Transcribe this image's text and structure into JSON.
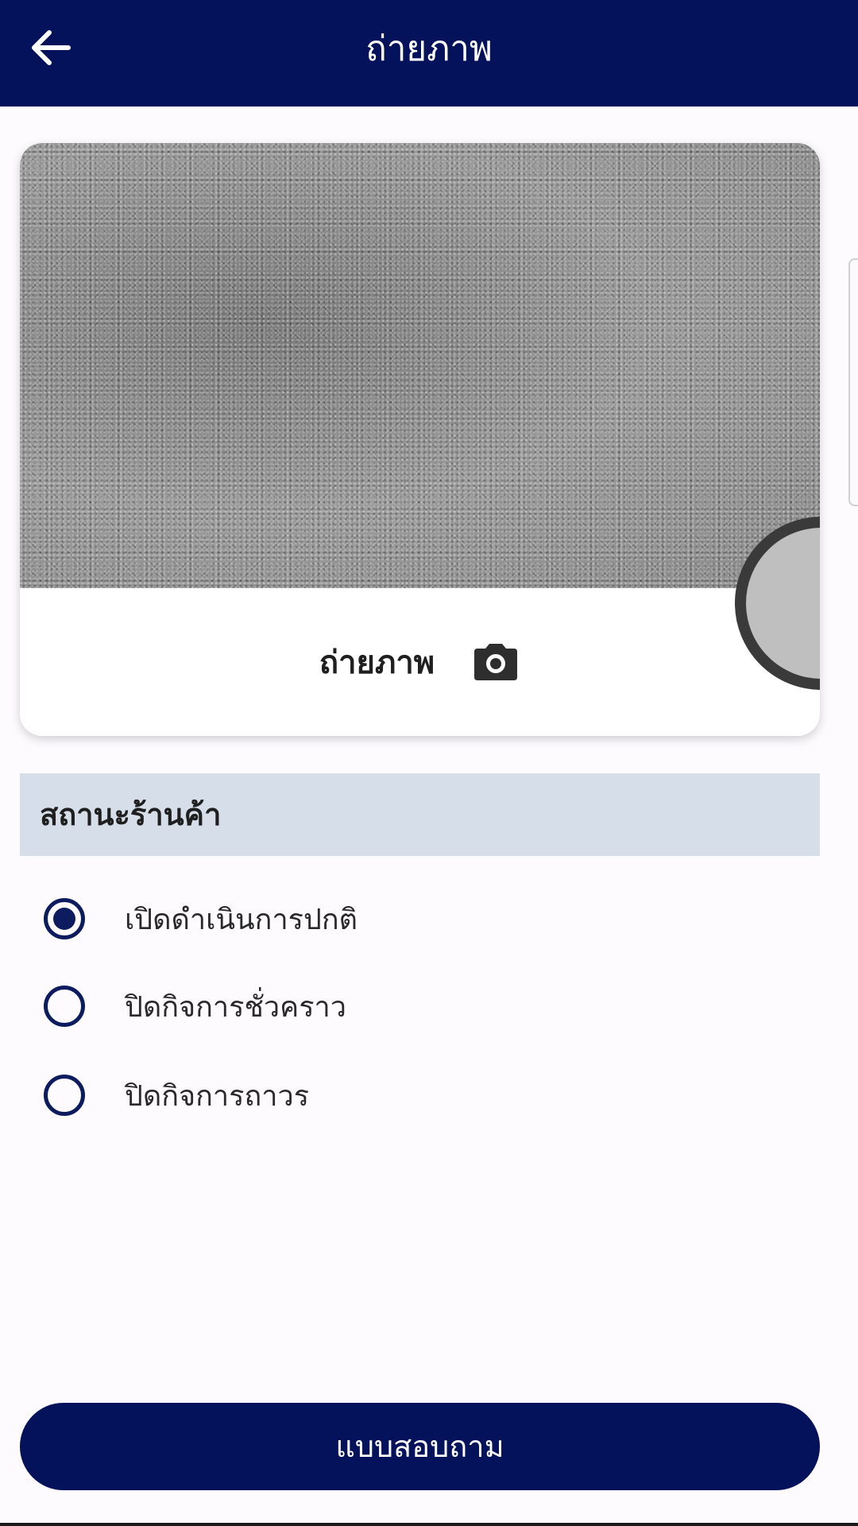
{
  "app_bar": {
    "title": "ถ่ายภาพ",
    "back_icon": "arrow-left-icon",
    "background_color": "#03125a"
  },
  "photo_card": {
    "take_photo_label": "ถ่ายภาพ",
    "camera_icon": "camera-icon"
  },
  "store_status": {
    "title": "สถานะร้านค้า",
    "options": [
      {
        "label": "เปิดดำเนินการปกติ",
        "selected": true
      },
      {
        "label": "ปิดกิจการชั่วคราว",
        "selected": false
      },
      {
        "label": "ปิดกิจการถาวร",
        "selected": false
      }
    ]
  },
  "survey_button": {
    "label": "แบบสอบถาม"
  },
  "colors": {
    "primary": "#03125a",
    "section_header_bg": "#d6dfe9",
    "radio": "#0c1c5e"
  }
}
